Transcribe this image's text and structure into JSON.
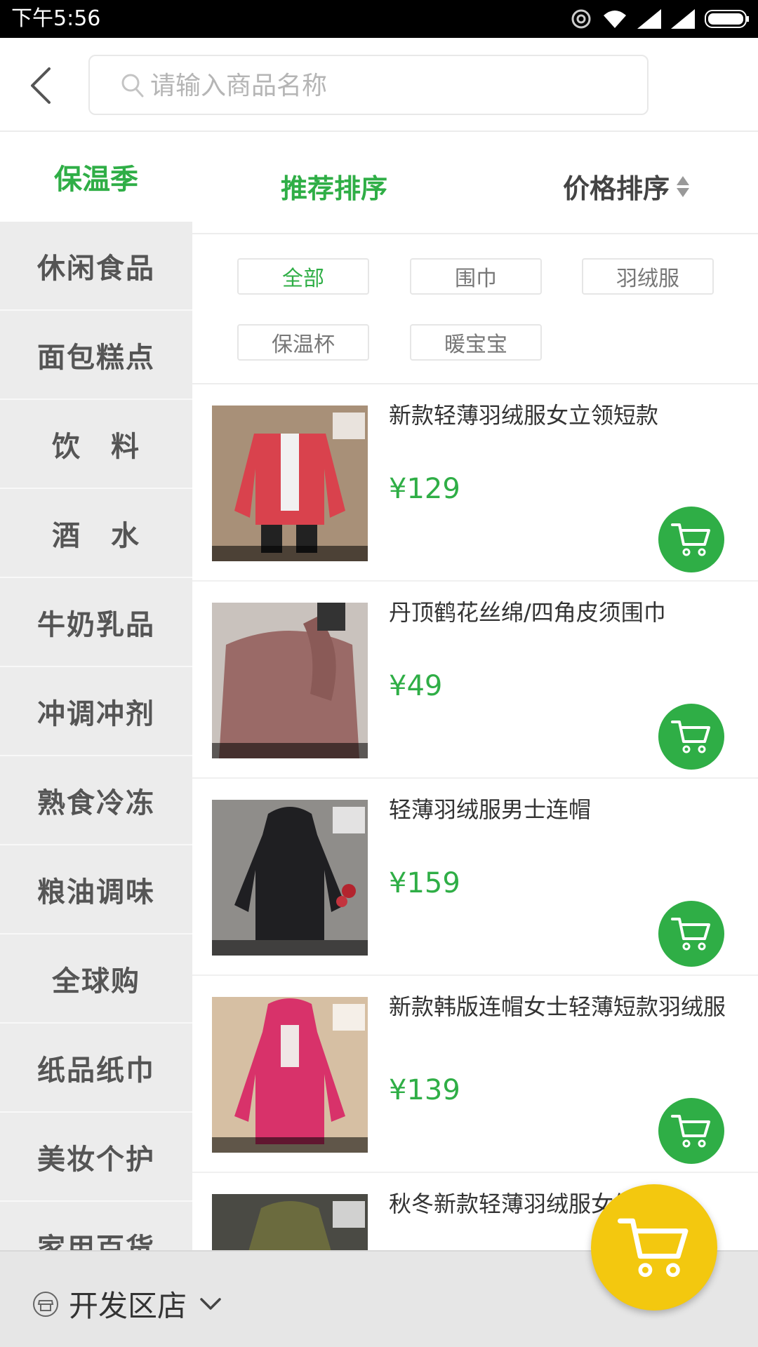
{
  "status_bar": {
    "time": "下午5:56"
  },
  "search": {
    "placeholder": "请输入商品名称"
  },
  "sidebar": {
    "active": "保温季",
    "items": [
      "休闲食品",
      "面包糕点",
      "饮　料",
      "酒　水",
      "牛奶乳品",
      "冲调冲剂",
      "熟食冷冻",
      "粮油调味",
      "全球购",
      "纸品纸巾",
      "美妆个护",
      "家用百货"
    ]
  },
  "sort": {
    "recommended": "推荐排序",
    "price": "价格排序"
  },
  "filters": [
    "全部",
    "围巾",
    "羽绒服",
    "保温杯",
    "暖宝宝"
  ],
  "products": [
    {
      "name": "新款轻薄羽绒服女立领短款",
      "price": "¥129"
    },
    {
      "name": "丹顶鹤花丝绵/四角皮须围巾",
      "price": "¥49"
    },
    {
      "name": "轻薄羽绒服男士连帽",
      "price": "¥159"
    },
    {
      "name": "新款韩版连帽女士轻薄短款羽绒服",
      "price": "¥139"
    },
    {
      "name": "秋冬新款轻薄羽绒服女修身",
      "price": ""
    }
  ],
  "store": {
    "name": "开发区店"
  },
  "colors": {
    "accent": "#2fae46",
    "fab": "#f3c80f"
  },
  "icons": [
    "back-arrow-icon",
    "search-icon",
    "cart-icon",
    "store-icon",
    "chevron-down-icon",
    "sort-arrows-icon"
  ]
}
